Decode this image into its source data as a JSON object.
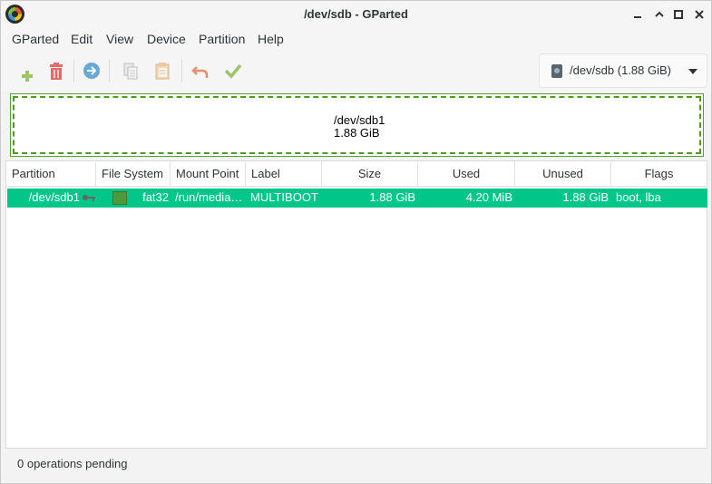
{
  "window": {
    "title": "/dev/sdb - GParted",
    "controls": {
      "minimize": "−",
      "maximize": "□",
      "close": "×"
    }
  },
  "menubar": {
    "items": [
      "GParted",
      "Edit",
      "View",
      "Device",
      "Partition",
      "Help"
    ]
  },
  "toolbar": {
    "buttons": [
      {
        "name": "new-partition",
        "icon": "plus-icon",
        "enabled": false
      },
      {
        "name": "delete-partition",
        "icon": "trash-icon",
        "enabled": true
      },
      {
        "name": "resize-move",
        "icon": "arrow-right-circle-icon",
        "enabled": true
      },
      {
        "name": "copy",
        "icon": "copy-icon",
        "enabled": true
      },
      {
        "name": "paste",
        "icon": "paste-icon",
        "enabled": false
      },
      {
        "name": "undo",
        "icon": "undo-icon",
        "enabled": false
      },
      {
        "name": "apply",
        "icon": "checkmark-icon",
        "enabled": false
      }
    ],
    "device_selector": {
      "label": "/dev/sdb (1.88 GiB)",
      "icon": "disk-icon"
    }
  },
  "diskmap": {
    "partition_name": "/dev/sdb1",
    "partition_size": "1.88 GiB",
    "color": "#4f9a1f"
  },
  "table": {
    "columns": [
      "Partition",
      "File System",
      "Mount Point",
      "Label",
      "Size",
      "Used",
      "Unused",
      "Flags"
    ],
    "rows": [
      {
        "partition": "/dev/sdb1",
        "mounted_icon": "key-icon",
        "filesystem": "fat32",
        "filesystem_color": "#4e9a3a",
        "mount_point": "/run/media…",
        "label": "MULTIBOOT",
        "size": "1.88 GiB",
        "used": "4.20 MiB",
        "unused": "1.88 GiB",
        "flags": "boot, lba",
        "selected": true
      }
    ],
    "selection_color": "#00c68a"
  },
  "statusbar": {
    "text": "0 operations pending"
  }
}
